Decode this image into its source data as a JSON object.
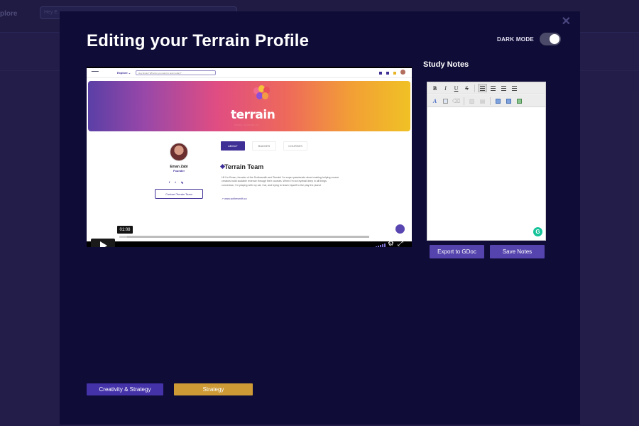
{
  "background": {
    "nav_explore": "plore",
    "search_placeholder": "Hey E..."
  },
  "modal": {
    "title": "Editing your Terrain Profile",
    "dark_mode_label": "DARK MODE",
    "dark_mode_on": true,
    "close_icon": "close-icon"
  },
  "video": {
    "timestamp": "01:08",
    "progress_fraction": 0.03,
    "frame": {
      "explore": "Explore ⌄",
      "search_placeholder": "Hey Eman! What do you want to learn today?",
      "brand": "terrain",
      "tagline": "WHERE LEARNERS GO",
      "profile_name": "Eman Zabi",
      "profile_role": "Founder",
      "social": [
        "f",
        "t",
        "ig"
      ],
      "contact_button": "Contact Terrain Team",
      "tabs": [
        "ABOUT",
        "BADGES",
        "COURSES"
      ],
      "team_heading": "Terrain Team",
      "bio": "Hi! I'm Eman, founder of the Scribesmith and Terrain! I'm super passionate about making helping course creators build scalable revenue through their courses. When I'm not eyeball deep in all things conversion, I'm playing with my cat, Cat, and trying to teach myself to the play the piano!",
      "link": "www.scribesmith.co"
    }
  },
  "notes": {
    "title": "Study Notes",
    "toolbar_row1": [
      "B",
      "I",
      "U",
      "S"
    ],
    "toolbar_row2_color": "A",
    "grammarly_glyph": "G"
  },
  "buttons": {
    "export": "Export to GDoc",
    "save": "Save Notes"
  },
  "tags": {
    "creativity": "Creativity & Strategy",
    "strategy": "Strategy"
  },
  "colors": {
    "modal_bg": "#0f0c37",
    "button_purple": "#5544ad",
    "tag_purple": "#4432a9",
    "tag_gold": "#cd9a36"
  }
}
